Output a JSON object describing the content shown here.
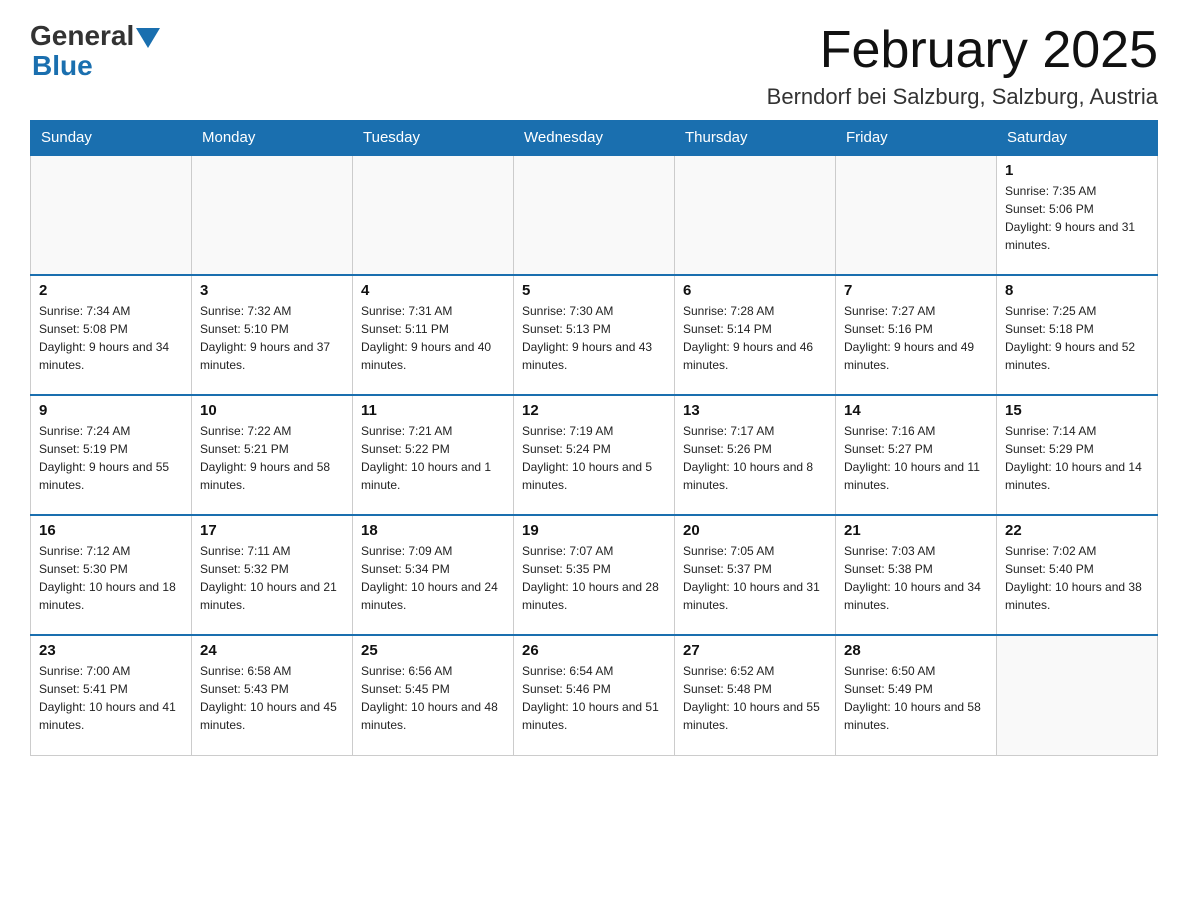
{
  "header": {
    "logo_general": "General",
    "logo_blue": "Blue",
    "month_title": "February 2025",
    "location": "Berndorf bei Salzburg, Salzburg, Austria"
  },
  "weekdays": [
    "Sunday",
    "Monday",
    "Tuesday",
    "Wednesday",
    "Thursday",
    "Friday",
    "Saturday"
  ],
  "weeks": [
    [
      {
        "day": "",
        "info": ""
      },
      {
        "day": "",
        "info": ""
      },
      {
        "day": "",
        "info": ""
      },
      {
        "day": "",
        "info": ""
      },
      {
        "day": "",
        "info": ""
      },
      {
        "day": "",
        "info": ""
      },
      {
        "day": "1",
        "info": "Sunrise: 7:35 AM\nSunset: 5:06 PM\nDaylight: 9 hours and 31 minutes."
      }
    ],
    [
      {
        "day": "2",
        "info": "Sunrise: 7:34 AM\nSunset: 5:08 PM\nDaylight: 9 hours and 34 minutes."
      },
      {
        "day": "3",
        "info": "Sunrise: 7:32 AM\nSunset: 5:10 PM\nDaylight: 9 hours and 37 minutes."
      },
      {
        "day": "4",
        "info": "Sunrise: 7:31 AM\nSunset: 5:11 PM\nDaylight: 9 hours and 40 minutes."
      },
      {
        "day": "5",
        "info": "Sunrise: 7:30 AM\nSunset: 5:13 PM\nDaylight: 9 hours and 43 minutes."
      },
      {
        "day": "6",
        "info": "Sunrise: 7:28 AM\nSunset: 5:14 PM\nDaylight: 9 hours and 46 minutes."
      },
      {
        "day": "7",
        "info": "Sunrise: 7:27 AM\nSunset: 5:16 PM\nDaylight: 9 hours and 49 minutes."
      },
      {
        "day": "8",
        "info": "Sunrise: 7:25 AM\nSunset: 5:18 PM\nDaylight: 9 hours and 52 minutes."
      }
    ],
    [
      {
        "day": "9",
        "info": "Sunrise: 7:24 AM\nSunset: 5:19 PM\nDaylight: 9 hours and 55 minutes."
      },
      {
        "day": "10",
        "info": "Sunrise: 7:22 AM\nSunset: 5:21 PM\nDaylight: 9 hours and 58 minutes."
      },
      {
        "day": "11",
        "info": "Sunrise: 7:21 AM\nSunset: 5:22 PM\nDaylight: 10 hours and 1 minute."
      },
      {
        "day": "12",
        "info": "Sunrise: 7:19 AM\nSunset: 5:24 PM\nDaylight: 10 hours and 5 minutes."
      },
      {
        "day": "13",
        "info": "Sunrise: 7:17 AM\nSunset: 5:26 PM\nDaylight: 10 hours and 8 minutes."
      },
      {
        "day": "14",
        "info": "Sunrise: 7:16 AM\nSunset: 5:27 PM\nDaylight: 10 hours and 11 minutes."
      },
      {
        "day": "15",
        "info": "Sunrise: 7:14 AM\nSunset: 5:29 PM\nDaylight: 10 hours and 14 minutes."
      }
    ],
    [
      {
        "day": "16",
        "info": "Sunrise: 7:12 AM\nSunset: 5:30 PM\nDaylight: 10 hours and 18 minutes."
      },
      {
        "day": "17",
        "info": "Sunrise: 7:11 AM\nSunset: 5:32 PM\nDaylight: 10 hours and 21 minutes."
      },
      {
        "day": "18",
        "info": "Sunrise: 7:09 AM\nSunset: 5:34 PM\nDaylight: 10 hours and 24 minutes."
      },
      {
        "day": "19",
        "info": "Sunrise: 7:07 AM\nSunset: 5:35 PM\nDaylight: 10 hours and 28 minutes."
      },
      {
        "day": "20",
        "info": "Sunrise: 7:05 AM\nSunset: 5:37 PM\nDaylight: 10 hours and 31 minutes."
      },
      {
        "day": "21",
        "info": "Sunrise: 7:03 AM\nSunset: 5:38 PM\nDaylight: 10 hours and 34 minutes."
      },
      {
        "day": "22",
        "info": "Sunrise: 7:02 AM\nSunset: 5:40 PM\nDaylight: 10 hours and 38 minutes."
      }
    ],
    [
      {
        "day": "23",
        "info": "Sunrise: 7:00 AM\nSunset: 5:41 PM\nDaylight: 10 hours and 41 minutes."
      },
      {
        "day": "24",
        "info": "Sunrise: 6:58 AM\nSunset: 5:43 PM\nDaylight: 10 hours and 45 minutes."
      },
      {
        "day": "25",
        "info": "Sunrise: 6:56 AM\nSunset: 5:45 PM\nDaylight: 10 hours and 48 minutes."
      },
      {
        "day": "26",
        "info": "Sunrise: 6:54 AM\nSunset: 5:46 PM\nDaylight: 10 hours and 51 minutes."
      },
      {
        "day": "27",
        "info": "Sunrise: 6:52 AM\nSunset: 5:48 PM\nDaylight: 10 hours and 55 minutes."
      },
      {
        "day": "28",
        "info": "Sunrise: 6:50 AM\nSunset: 5:49 PM\nDaylight: 10 hours and 58 minutes."
      },
      {
        "day": "",
        "info": ""
      }
    ]
  ]
}
